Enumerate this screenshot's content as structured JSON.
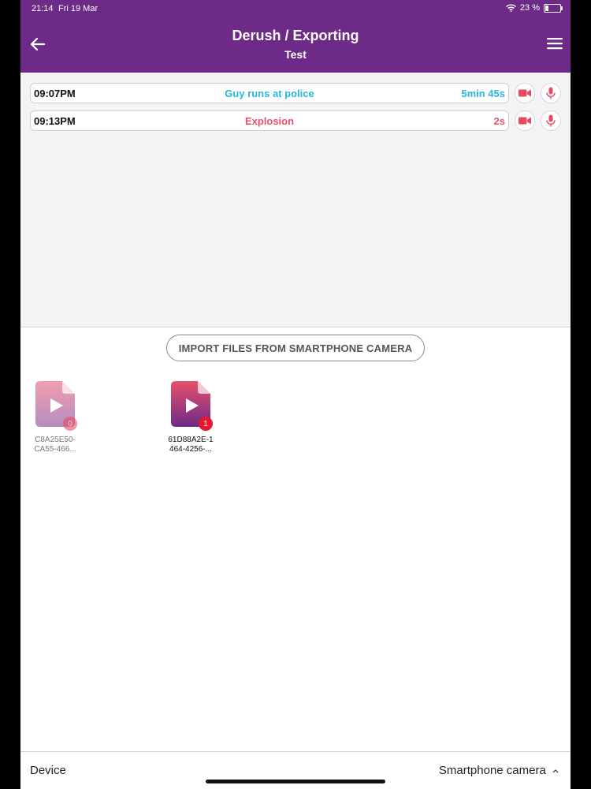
{
  "status_bar": {
    "time": "21:14",
    "date": "Fri 19 Mar",
    "battery": "23 %"
  },
  "header": {
    "title": "Derush / Exporting",
    "subtitle": "Test"
  },
  "timeline": [
    {
      "time": "09:07PM",
      "label": "Guy runs at police",
      "duration": "5min 45s",
      "color": "#29b6e0"
    },
    {
      "time": "09:13PM",
      "label": "Explosion",
      "duration": "2s",
      "color": "#e8506a"
    }
  ],
  "import_button": "IMPORT FILES FROM SMARTPHONE CAMERA",
  "files": [
    {
      "name_line1": "C8A25E50-",
      "name_line2": "CA55-466...",
      "badge": "0",
      "state": "faded"
    },
    {
      "name_line1": "61D88A2E-1",
      "name_line2": "464-4256-...",
      "badge": "1",
      "state": "active"
    }
  ],
  "footer": {
    "left_label": "Device",
    "right_label": "Smartphone camera"
  },
  "colors": {
    "header_bg": "#6e2a87",
    "accent_red": "#e84a5f",
    "accent_cyan": "#29b6e0"
  },
  "icons": {
    "back": "arrow-left-icon",
    "menu": "hamburger-icon",
    "camera": "video-camera-icon",
    "mic": "microphone-icon",
    "file": "video-file-icon",
    "chevron": "chevron-up-icon"
  }
}
